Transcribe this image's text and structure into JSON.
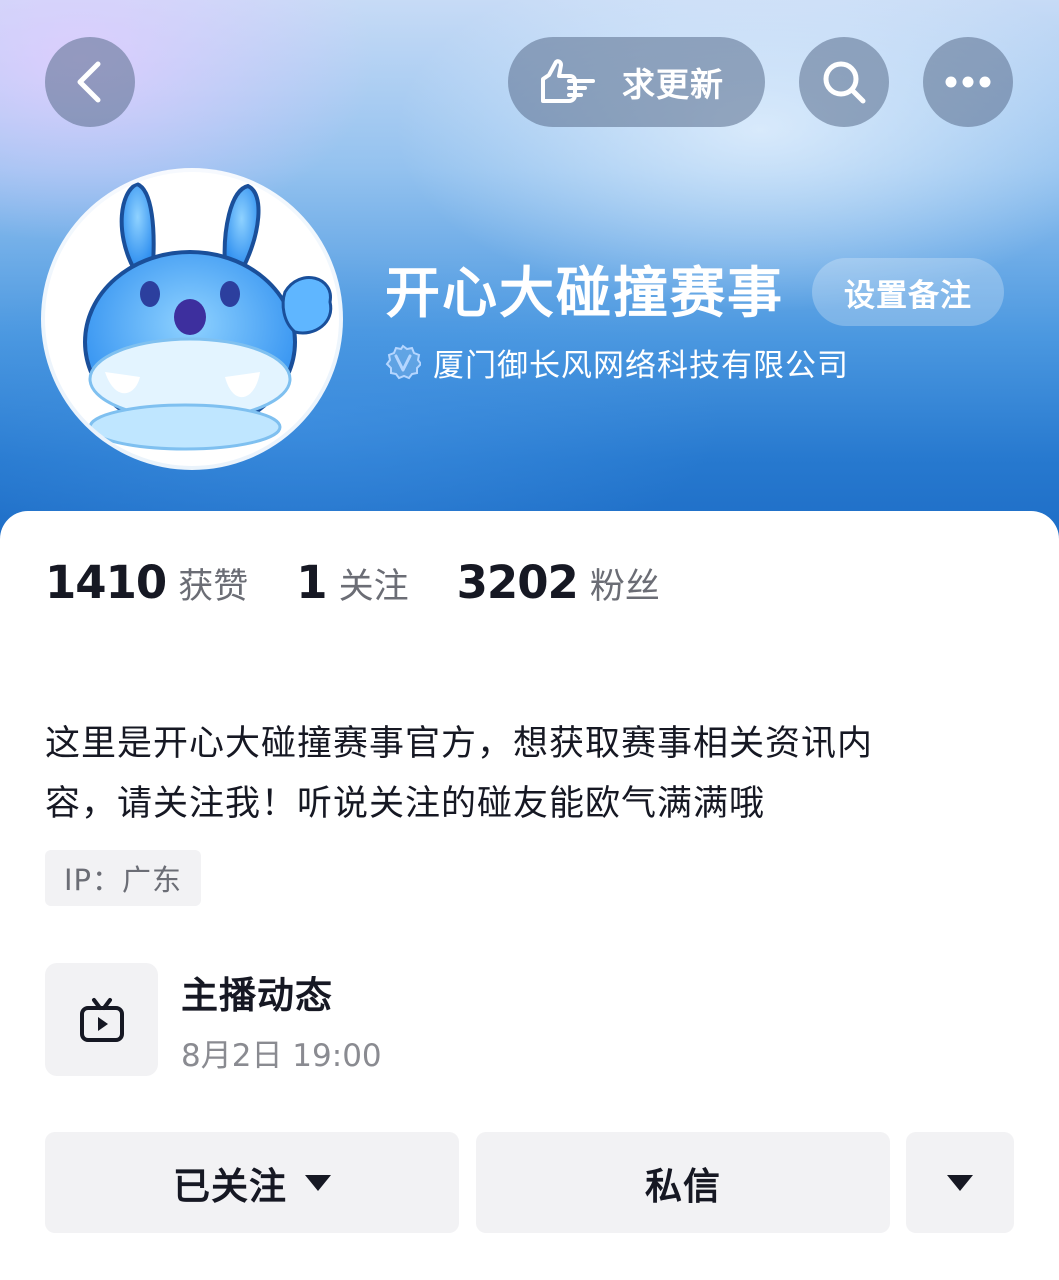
{
  "top_bar": {
    "request_update_label": "求更新"
  },
  "profile": {
    "name": "开心大碰撞赛事",
    "remark_button": "设置备注",
    "verification": "厦门御长风网络科技有限公司"
  },
  "stats": [
    {
      "value": "1410",
      "label": "获赞"
    },
    {
      "value": "1",
      "label": "关注"
    },
    {
      "value": "3202",
      "label": "粉丝"
    }
  ],
  "bio": {
    "line1": "这里是开心大碰撞赛事官方，想获取赛事相关资讯内",
    "line2": "容，请关注我！听说关注的碰友能欧气满满哦"
  },
  "ip_tag": "IP：广东",
  "live": {
    "title": "主播动态",
    "time": "8月2日 19:00"
  },
  "actions": {
    "follow": "已关注",
    "message": "私信"
  },
  "colors": {
    "accent_blue": "#2779cf",
    "text_primary": "#161823",
    "text_secondary": "#6b6d75",
    "button_bg": "#f2f2f4"
  }
}
